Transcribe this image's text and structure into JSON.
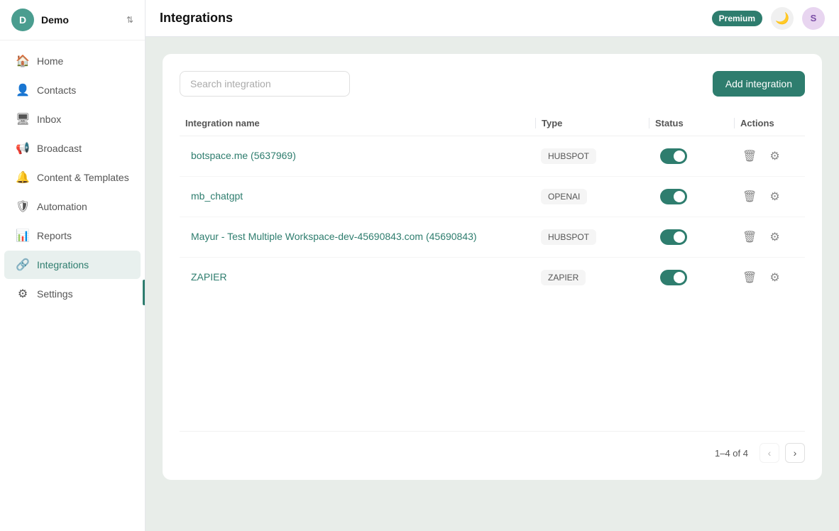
{
  "workspace": {
    "initial": "D",
    "name": "Demo",
    "color": "#4a9d8f"
  },
  "topbar": {
    "title": "Integrations",
    "premium_label": "Premium",
    "theme_icon": "🌙",
    "user_initial": "S",
    "user_color": "#e8d5f0"
  },
  "sidebar": {
    "items": [
      {
        "id": "home",
        "label": "Home",
        "icon": "🏠",
        "active": false
      },
      {
        "id": "contacts",
        "label": "Contacts",
        "icon": "👤",
        "active": false
      },
      {
        "id": "inbox",
        "label": "Inbox",
        "icon": "🖥",
        "active": false
      },
      {
        "id": "broadcast",
        "label": "Broadcast",
        "icon": "📢",
        "active": false
      },
      {
        "id": "content",
        "label": "Content & Templates",
        "icon": "🔔",
        "active": false
      },
      {
        "id": "automation",
        "label": "Automation",
        "icon": "🛡",
        "active": false
      },
      {
        "id": "reports",
        "label": "Reports",
        "icon": "📊",
        "active": false
      },
      {
        "id": "integrations",
        "label": "Integrations",
        "icon": "🔗",
        "active": true
      },
      {
        "id": "settings",
        "label": "Settings",
        "icon": "⚙",
        "active": false
      }
    ]
  },
  "search": {
    "placeholder": "Search integration"
  },
  "add_button_label": "Add integration",
  "table": {
    "headers": [
      "Integration name",
      "Type",
      "Status",
      "Actions"
    ],
    "rows": [
      {
        "name": "botspace.me (5637969)",
        "type": "HUBSPOT",
        "enabled": true
      },
      {
        "name": "mb_chatgpt",
        "type": "OPENAI",
        "enabled": true
      },
      {
        "name": "Mayur - Test Multiple Workspace-dev-45690843.com (45690843)",
        "type": "HUBSPOT",
        "enabled": true
      },
      {
        "name": "ZAPIER",
        "type": "ZAPIER",
        "enabled": true
      }
    ]
  },
  "pagination": {
    "info": "1–4 of 4",
    "of_label": "of 4"
  }
}
